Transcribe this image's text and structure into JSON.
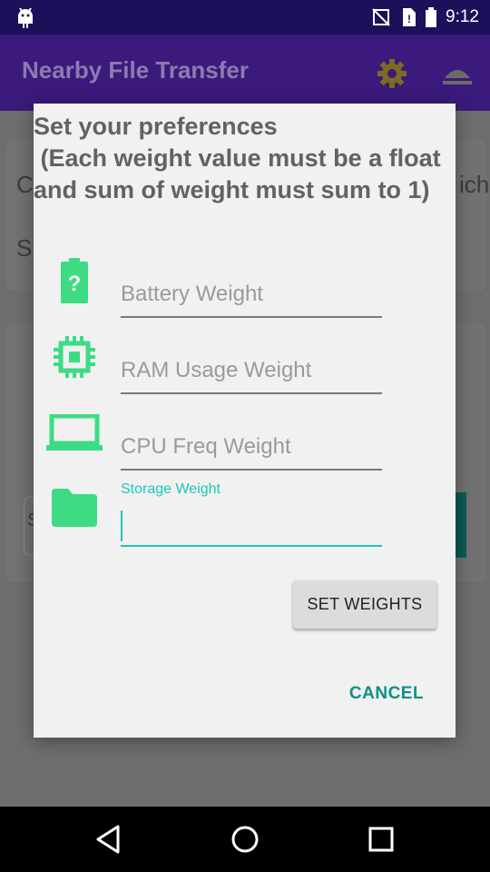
{
  "status_bar": {
    "time": "9:12",
    "icons": [
      "android-icon",
      "notifications-off-icon",
      "no-sim-icon",
      "battery-icon"
    ]
  },
  "app_bar": {
    "title": "Nearby File Transfer",
    "actions": [
      "settings-gear-icon",
      "eject-icon"
    ]
  },
  "background": {
    "card1_letters": [
      "C",
      "S"
    ],
    "card1_trailing": "ich",
    "card2_letter": "S"
  },
  "dialog": {
    "title": "Set your preferences\n (Each weight value must be a float and sum of weight must sum to 1)",
    "fields": [
      {
        "placeholder": "Battery Weight",
        "icon": "battery-unknown-icon"
      },
      {
        "placeholder": "RAM Usage Weight",
        "icon": "memory-chip-icon"
      },
      {
        "placeholder": "CPU Freq Weight",
        "icon": "laptop-icon"
      },
      {
        "label": "Storage Weight",
        "value": "",
        "icon": "folder-icon",
        "focused": true
      }
    ],
    "set_button": "SET WEIGHTS",
    "cancel_button": "CANCEL"
  },
  "colors": {
    "accent": "#19c8b9",
    "icon_green": "#3ddc84",
    "primary_dark": "#1d0f5a"
  },
  "nav_bar": {
    "buttons": [
      "back-icon",
      "home-icon",
      "recents-icon"
    ]
  }
}
